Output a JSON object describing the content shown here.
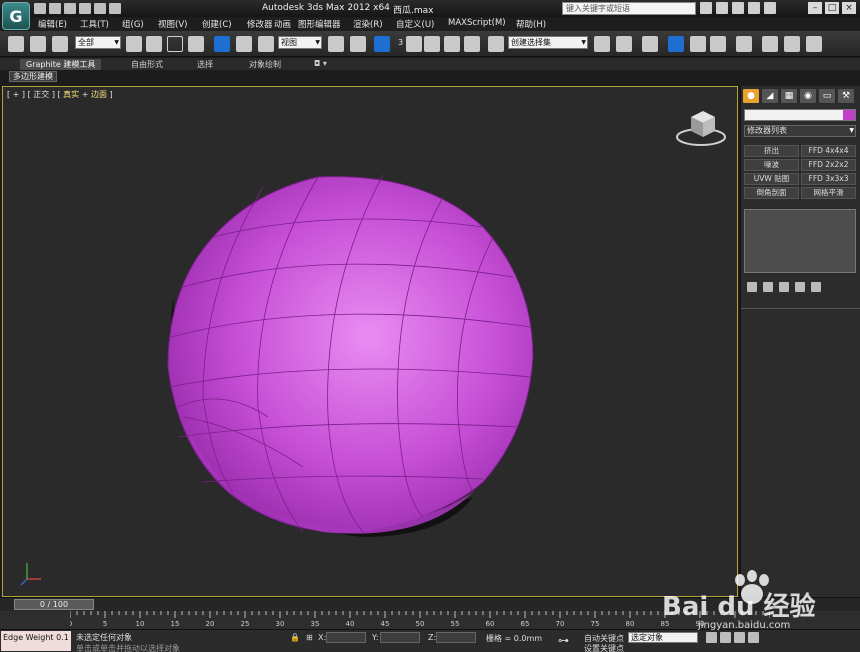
{
  "window": {
    "title": "Autodesk 3ds Max  2012 x64",
    "file_name": "西瓜.max",
    "search_placeholder": "键入关键字或短语",
    "logo_letter": "G"
  },
  "menu": {
    "items": [
      "编辑(E)",
      "工具(T)",
      "组(G)",
      "视图(V)",
      "创建(C)",
      "修改器",
      "动画",
      "图形编辑器",
      "渲染(R)",
      "自定义(U)",
      "MAXScript(M)",
      "帮助(H)"
    ]
  },
  "toolbar": {
    "selection_filter": "全部",
    "ref_coord": "视图",
    "named_selection": "创建选择集",
    "snap_label": "3"
  },
  "ribbon": {
    "tabs": [
      "Graphite 建模工具",
      "自由形式",
      "选择",
      "对象绘制"
    ],
    "sub_tab": "多边形建模"
  },
  "viewport": {
    "label_bracket_open": "[",
    "label_plus": "+",
    "label_sep": "]",
    "label_view": "正交",
    "label_shading": "真实",
    "label_edge": "边面",
    "object_color": "#c850d8"
  },
  "command_panel": {
    "modifier_list": "修改器列表",
    "buttons": [
      "挤出",
      "FFD 4x4x4",
      "噪波",
      "FFD 2x2x2",
      "UVW 贴图",
      "FFD 3x3x3",
      "倒角剖面",
      "网格平滑"
    ]
  },
  "timeline": {
    "frame_display": "0 / 100",
    "ticks": [
      "0",
      "5",
      "10",
      "15",
      "20",
      "25",
      "30",
      "35",
      "40",
      "45",
      "50",
      "55",
      "60",
      "65",
      "70",
      "75",
      "80",
      "85",
      "90"
    ]
  },
  "status": {
    "maxscript_text": "Edge Weight 0.1",
    "selection_msg": "未选定任何对象",
    "x_label": "X:",
    "y_label": "Y:",
    "z_label": "Z:",
    "grid": "栅格 = 0.0mm",
    "auto_key": "自动关键点",
    "set_key": "设置关键点",
    "selected_obj": "选定对象",
    "hint": "单击或单击并拖动以选择对象"
  },
  "watermark": {
    "brand": "Bai du 经验",
    "url": "jingyan.baidu.com"
  }
}
